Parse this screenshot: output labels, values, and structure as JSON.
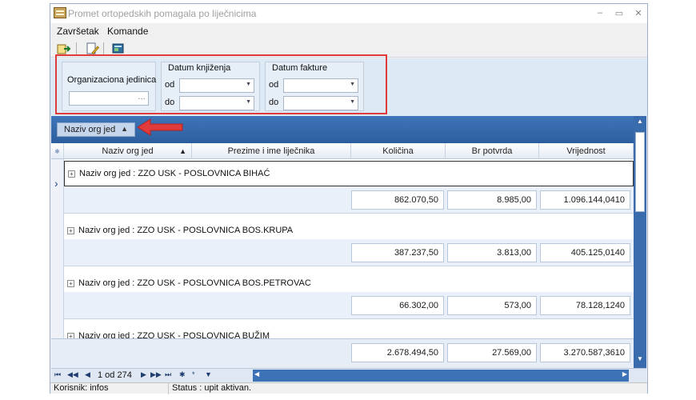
{
  "window": {
    "title": "Promet ortopedskih pomagala po liječnicima",
    "controls": {
      "minimize": "–",
      "maximize": "▭",
      "close": "✕"
    }
  },
  "menu": {
    "items": [
      "Završetak",
      "Komande"
    ]
  },
  "toolbar": {
    "icons": [
      "exit-icon",
      "edit-document-icon",
      "report-icon"
    ]
  },
  "filters": {
    "org_unit": {
      "label": "Organizaciona jedinica",
      "value": "",
      "button": "…"
    },
    "booking_date": {
      "title": "Datum knjiženja",
      "from_label": "od",
      "to_label": "do",
      "from_value": "",
      "to_value": ""
    },
    "invoice_date": {
      "title": "Datum fakture",
      "from_label": "od",
      "to_label": "do",
      "from_value": "",
      "to_value": ""
    }
  },
  "grid": {
    "group_chip": {
      "label": "Naziv org jed",
      "sort": "▲"
    },
    "columns": [
      {
        "label": "Naziv org jed",
        "sort": "▲"
      },
      {
        "label": "Prezime i ime liječnika"
      },
      {
        "label": "Količina"
      },
      {
        "label": "Br potvrda"
      },
      {
        "label": "Vrijednost"
      }
    ],
    "groups": [
      {
        "label": "Naziv org jed : ZZO USK - POSLOVNICA BIHAĆ",
        "kolicina": "862.070,50",
        "br_potvrda": "8.985,00",
        "vrijednost": "1.096.144,0410"
      },
      {
        "label": "Naziv org jed : ZZO USK - POSLOVNICA BOS.KRUPA",
        "kolicina": "387.237,50",
        "br_potvrda": "3.813,00",
        "vrijednost": "405.125,0140"
      },
      {
        "label": "Naziv org jed : ZZO USK - POSLOVNICA BOS.PETROVAC",
        "kolicina": "66.302,00",
        "br_potvrda": "573,00",
        "vrijednost": "78.128,1240"
      },
      {
        "label": "Naziv org jed : ZZO USK - POSLOVNICA BUŽIM"
      }
    ],
    "totals": {
      "kolicina": "2.678.494,50",
      "br_potvrda": "27.569,00",
      "vrijednost": "3.270.587,3610"
    },
    "row_indicator": "›"
  },
  "navigator": {
    "first": "⏮",
    "prev_page": "◀◀",
    "prev": "◀",
    "position": "1 od 274",
    "next": "▶",
    "next_page": "▶▶",
    "last": "⏭",
    "add": "✱",
    "edit": "*",
    "filter": "▼"
  },
  "status": {
    "user": "Korisnik: infos",
    "message": "Status : upit aktivan."
  },
  "colors": {
    "accent": "#2d5f9e",
    "highlight": "#e03a3a",
    "filter_bg": "#ddeaf6"
  }
}
